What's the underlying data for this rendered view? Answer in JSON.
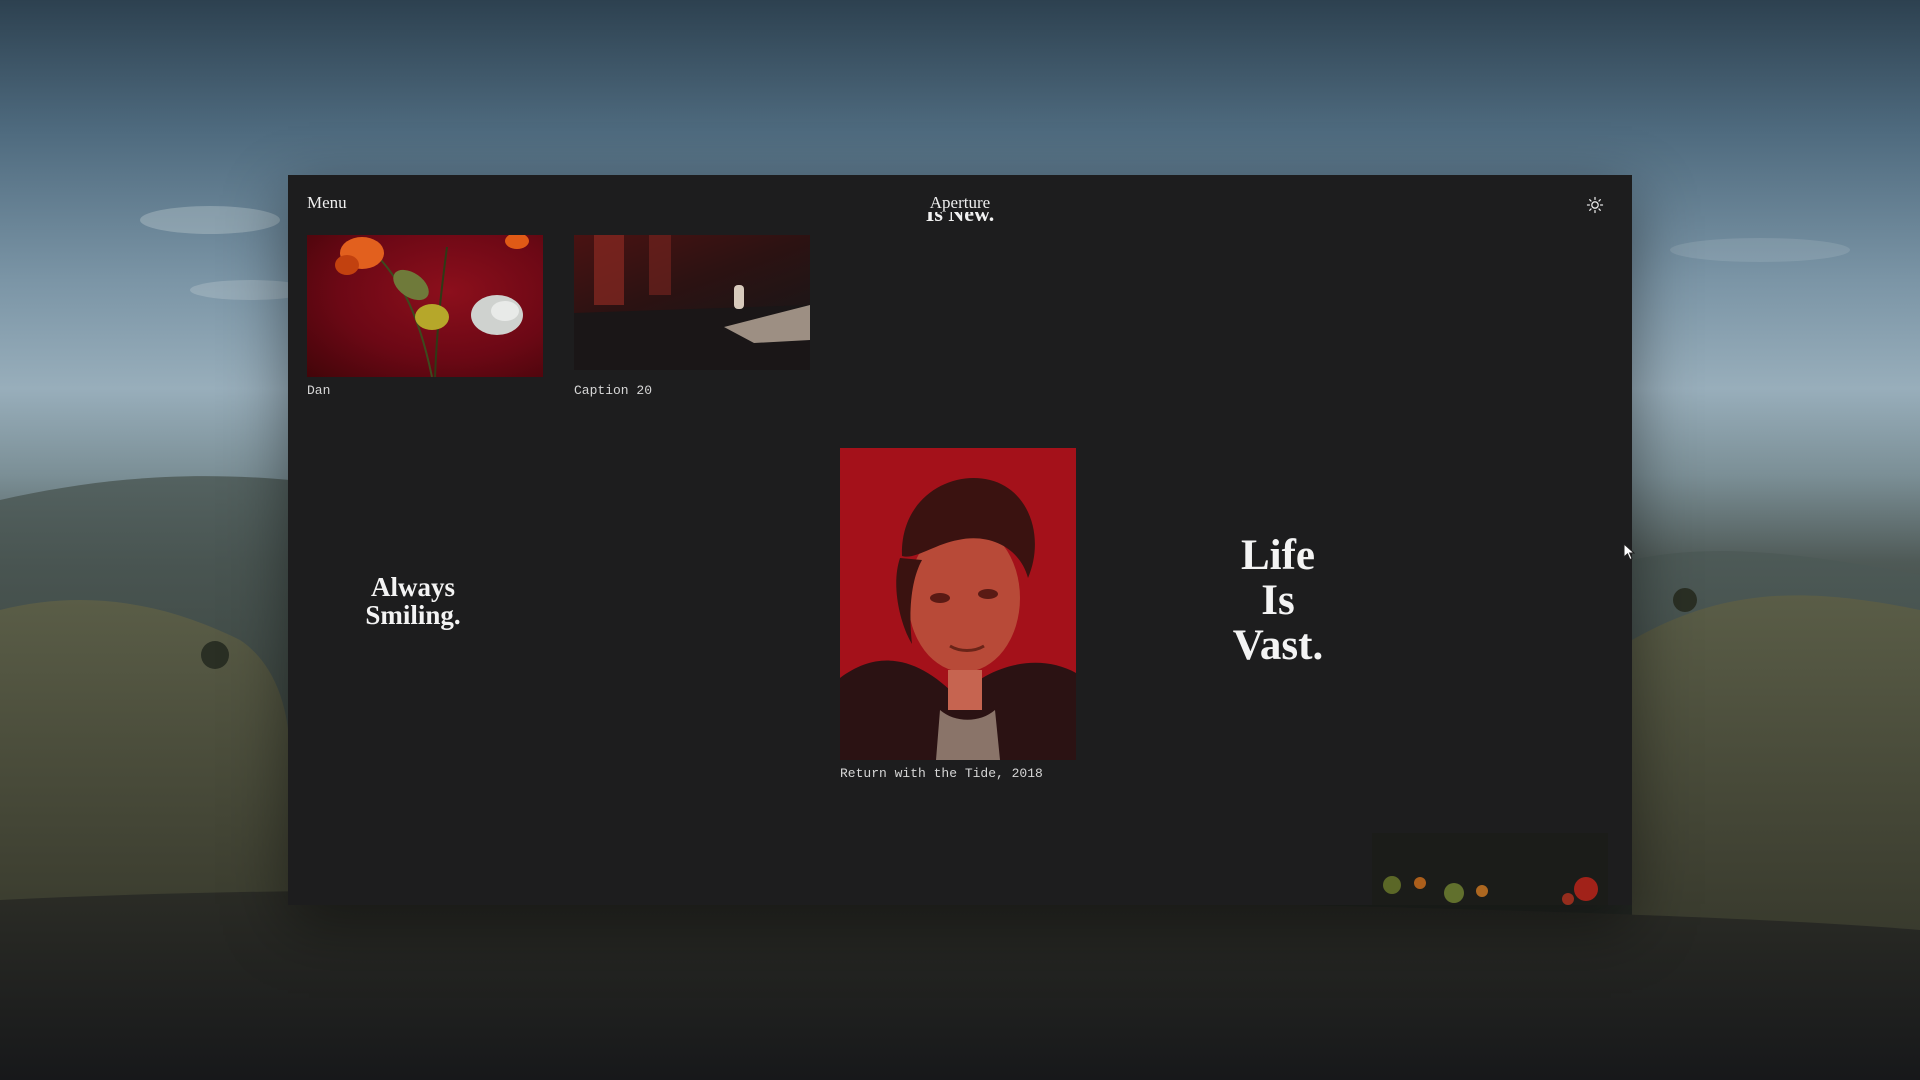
{
  "app": {
    "menu_label": "Menu",
    "title": "Aperture",
    "clipped_heading": "Is New."
  },
  "gallery": {
    "cards": [
      {
        "caption": "Dan"
      },
      {
        "caption": "Caption 20"
      },
      {
        "caption": "Return with the Tide, 2018"
      },
      {
        "caption": ""
      }
    ],
    "quotes": {
      "smiling": [
        "Always",
        "Smiling."
      ],
      "vast": [
        "Life",
        "Is",
        "Vast."
      ]
    }
  },
  "icons": {
    "theme_toggle": "sun-icon",
    "pointer": "mouse-cursor-icon"
  },
  "colors": {
    "window_background": "#1d1d1e",
    "text": "#eeeeee",
    "accent_red": "#b5121b"
  }
}
